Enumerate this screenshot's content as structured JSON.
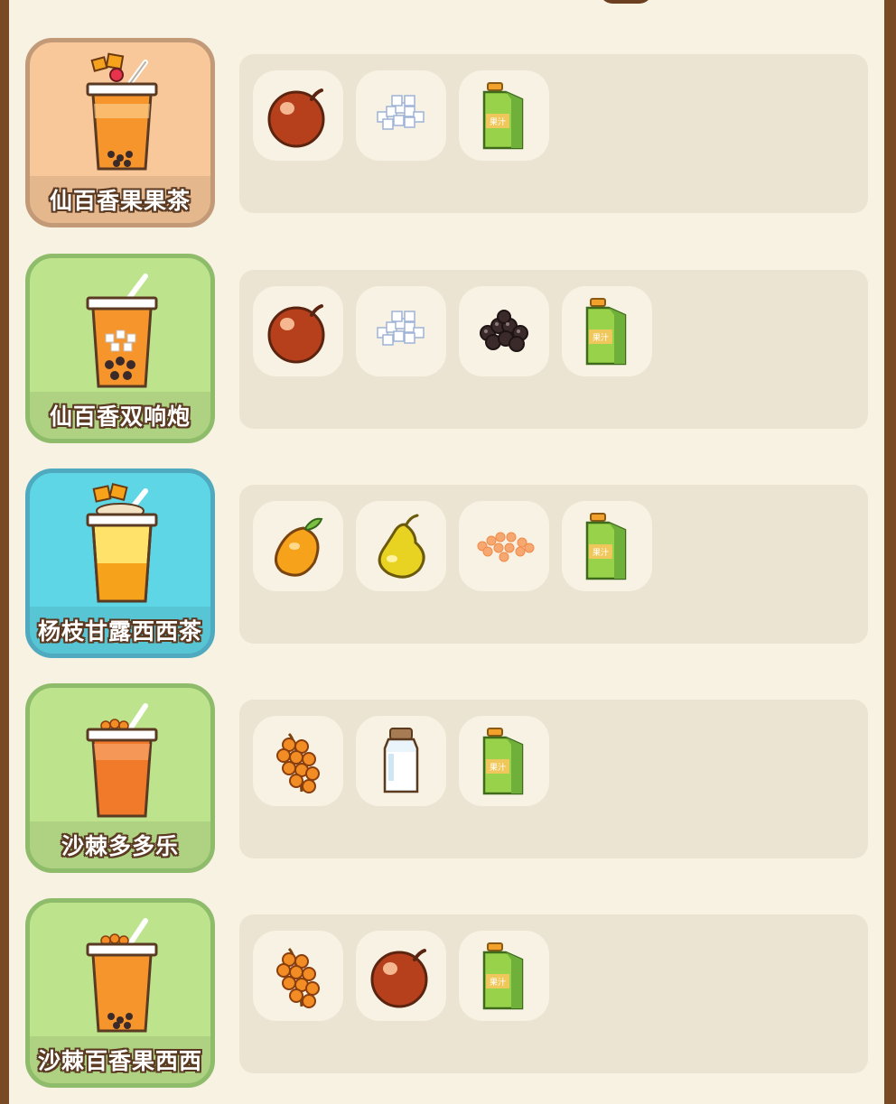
{
  "colors": {
    "frame": "#7a4a24",
    "panel": "#f7f2e2",
    "slot_panel": "#ebe4d2",
    "slot": "#f7f2e3",
    "card_orange": "#f8c79a",
    "card_green": "#bde48c",
    "card_blue": "#5fd6e6",
    "label_outline": "#5a3a22"
  },
  "recipes": [
    {
      "name": "仙百香果果茶",
      "card_tone": "orange",
      "drink_icon": "passionfruit-fruit-tea-cup-icon",
      "ingredients": [
        "passion-fruit-icon",
        "sugar-cubes-icon",
        "juice-carton-icon"
      ]
    },
    {
      "name": "仙百香双响炮",
      "card_tone": "green",
      "drink_icon": "passionfruit-double-boba-cup-icon",
      "ingredients": [
        "passion-fruit-icon",
        "sugar-cubes-icon",
        "boba-pearls-icon",
        "juice-carton-icon"
      ]
    },
    {
      "name": "杨枝甘露西西茶",
      "card_tone": "blue",
      "drink_icon": "mango-pomelo-sago-cup-icon",
      "ingredients": [
        "mango-icon",
        "yellow-pear-icon",
        "orange-sago-icon",
        "juice-carton-icon"
      ]
    },
    {
      "name": "沙棘多多乐",
      "card_tone": "green",
      "drink_icon": "sea-buckthorn-drink-cup-icon",
      "ingredients": [
        "sea-buckthorn-icon",
        "milk-bottle-icon",
        "juice-carton-icon"
      ]
    },
    {
      "name": "沙棘百香果西西",
      "card_tone": "green",
      "drink_icon": "sea-buckthorn-passionfruit-cup-icon",
      "ingredients": [
        "sea-buckthorn-icon",
        "passion-fruit-icon",
        "juice-carton-icon"
      ]
    }
  ]
}
